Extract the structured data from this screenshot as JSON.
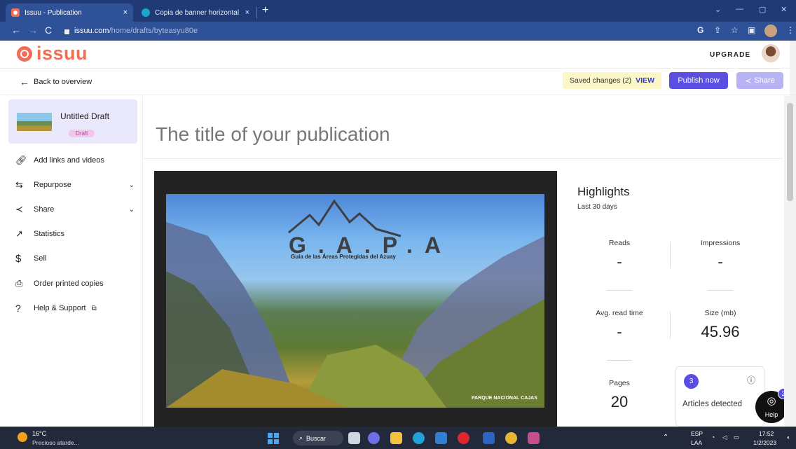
{
  "browser": {
    "tabs": [
      {
        "title": "Issuu - Publication",
        "close": "×"
      },
      {
        "title": "Copia de banner horizontal prod",
        "close": "×"
      }
    ],
    "new_tab": "+",
    "url_host": "issuu.com",
    "url_path": "/home/drafts/byteasyu80e",
    "window_controls": [
      "⌄",
      "—",
      "▢",
      "✕"
    ]
  },
  "header": {
    "logo_text": "issuu",
    "upgrade_label": "UPGRADE"
  },
  "action_bar": {
    "back_label": "Back to overview",
    "saved_changes": "Saved changes (2)",
    "view_label": "VIEW",
    "publish_label": "Publish now",
    "share_label": "Share"
  },
  "sidebar": {
    "draft_title": "Untitled Draft",
    "draft_badge": "Draft",
    "items": [
      {
        "label": "Add links and videos",
        "icon": "link-icon",
        "glyph": "🔗︎"
      },
      {
        "label": "Repurpose",
        "icon": "repurpose-icon",
        "glyph": "⇆",
        "chevron": "⌄"
      },
      {
        "label": "Share",
        "icon": "share-icon",
        "glyph": "≺",
        "chevron": "⌄"
      },
      {
        "label": "Statistics",
        "icon": "statistics-icon",
        "glyph": "↗"
      },
      {
        "label": "Sell",
        "icon": "dollar-icon",
        "glyph": "$"
      },
      {
        "label": "Order printed copies",
        "icon": "printer-icon",
        "glyph": "⎙"
      },
      {
        "label": "Help & Support",
        "icon": "help-icon",
        "glyph": "?",
        "external": "⧉"
      }
    ]
  },
  "main": {
    "publication_title": "The title of your publication",
    "cover": {
      "title": "G.A.P.A",
      "subtitle": "Guía de las Áreas Protegidas del Azuay",
      "caption": "PARQUE NACIONAL CAJAS"
    },
    "next_arrow": "›"
  },
  "highlights": {
    "heading": "Highlights",
    "period": "Last 30 days",
    "stats": {
      "reads": {
        "label": "Reads",
        "value": "-"
      },
      "impressions": {
        "label": "Impressions",
        "value": "-"
      },
      "avg_read_time": {
        "label": "Avg. read time",
        "value": "-"
      },
      "size": {
        "label": "Size (mb)",
        "value": "45.96"
      },
      "pages": {
        "label": "Pages",
        "value": "20"
      }
    },
    "articles": {
      "count": "3",
      "label": "Articles detected",
      "info": "ⓘ"
    }
  },
  "help": {
    "label": "Help",
    "badge": "2",
    "icon": "◎"
  },
  "taskbar": {
    "temperature": "16°C",
    "weather": "Precioso atarde...",
    "search": "Buscar",
    "language_1": "ESP",
    "language_2": "LAA",
    "time": "17:52",
    "date": "1/2/2023"
  }
}
